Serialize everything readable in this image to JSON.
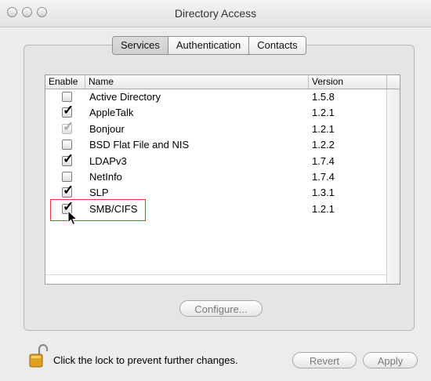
{
  "window": {
    "title": "Directory Access"
  },
  "tabs": [
    {
      "label": "Services",
      "selected": true
    },
    {
      "label": "Authentication",
      "selected": false
    },
    {
      "label": "Contacts",
      "selected": false
    }
  ],
  "table": {
    "headers": {
      "enable": "Enable",
      "name": "Name",
      "version": "Version"
    },
    "rows": [
      {
        "name": "Active Directory",
        "version": "1.5.8",
        "enabled": false,
        "dimmed": false
      },
      {
        "name": "AppleTalk",
        "version": "1.2.1",
        "enabled": true,
        "dimmed": false
      },
      {
        "name": "Bonjour",
        "version": "1.2.1",
        "enabled": true,
        "dimmed": true
      },
      {
        "name": "BSD Flat File and NIS",
        "version": "1.2.2",
        "enabled": false,
        "dimmed": false
      },
      {
        "name": "LDAPv3",
        "version": "1.7.4",
        "enabled": true,
        "dimmed": false
      },
      {
        "name": "NetInfo",
        "version": "1.7.4",
        "enabled": false,
        "dimmed": false
      },
      {
        "name": "SLP",
        "version": "1.3.1",
        "enabled": true,
        "dimmed": false
      },
      {
        "name": "SMB/CIFS",
        "version": "1.2.1",
        "enabled": true,
        "dimmed": false
      }
    ]
  },
  "buttons": {
    "configure": "Configure...",
    "revert": "Revert",
    "apply": "Apply"
  },
  "lock": {
    "text": "Click the lock to prevent further changes.",
    "icon": "lock-icon"
  },
  "colors": {
    "highlight": "#e13b35",
    "lock": "#e0a020"
  }
}
